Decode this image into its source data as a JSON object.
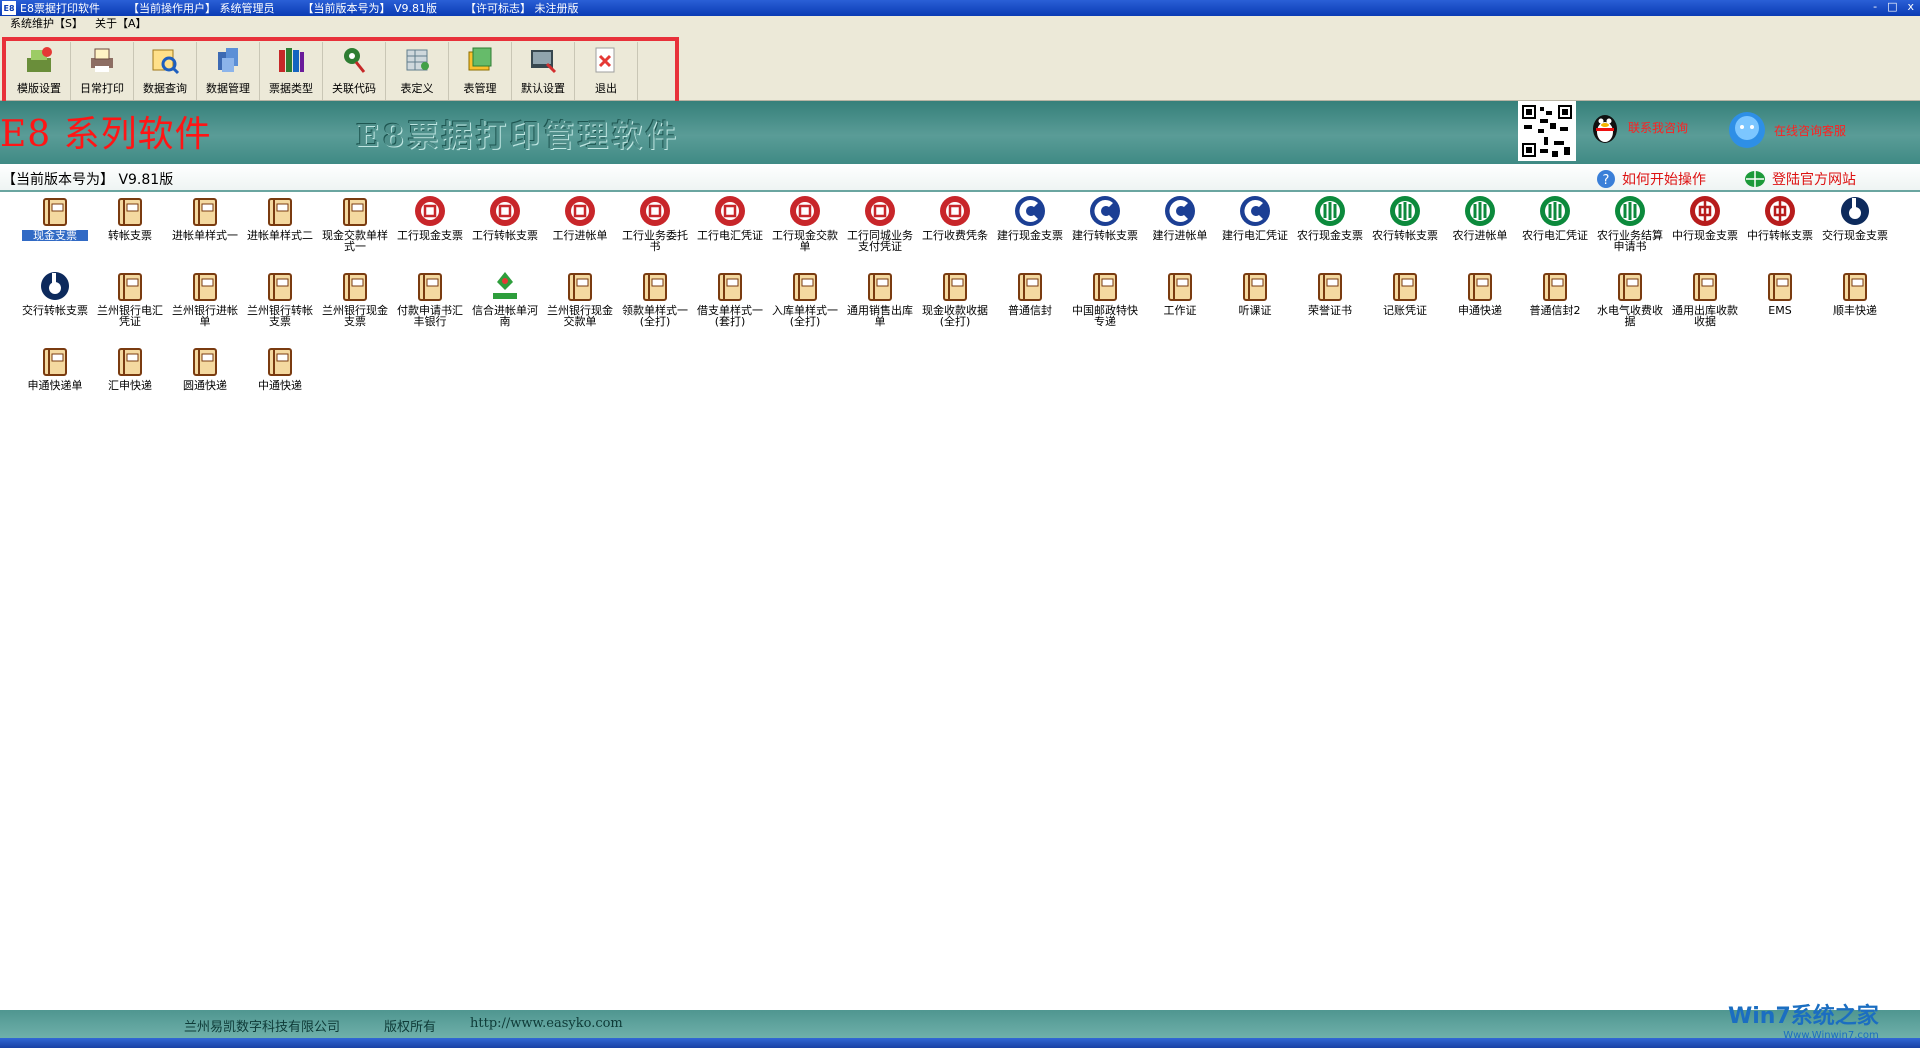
{
  "titlebar": {
    "app_name": "E8票据打印软件",
    "current_user": "【当前操作用户】 系统管理员",
    "current_version": "【当前版本号为】 V9.81版",
    "license": "【许可标志】 未注册版",
    "controls": [
      "-",
      "□",
      "x"
    ]
  },
  "menubar": {
    "items": [
      "系统维护【S】",
      "关于【A】"
    ]
  },
  "toolbar": {
    "buttons": [
      {
        "label": "模版设置",
        "icon": "template-settings-icon"
      },
      {
        "label": "日常打印",
        "icon": "printer-icon"
      },
      {
        "label": "数据查询",
        "icon": "search-icon"
      },
      {
        "label": "数据管理",
        "icon": "data-manage-icon"
      },
      {
        "label": "票据类型",
        "icon": "books-icon"
      },
      {
        "label": "关联代码",
        "icon": "link-code-icon"
      },
      {
        "label": "表定义",
        "icon": "table-define-icon"
      },
      {
        "label": "表管理",
        "icon": "table-manage-icon"
      },
      {
        "label": "默认设置",
        "icon": "default-settings-icon"
      },
      {
        "label": "退出",
        "icon": "exit-icon"
      }
    ]
  },
  "banner": {
    "series_title": "E8 系列软件",
    "product_title": "E8票据打印管理软件",
    "qq_contact": "联系我咨询",
    "online_support": "在线咨询客服"
  },
  "version_line": {
    "version": "【当前版本号为】 V9.81版",
    "how_to": "如何开始操作",
    "website": "登陆官方网站"
  },
  "items": [
    {
      "label": "现金支票",
      "icon": "book"
    },
    {
      "label": "转帐支票",
      "icon": "book"
    },
    {
      "label": "进帐单样式一",
      "icon": "book"
    },
    {
      "label": "进帐单样式二",
      "icon": "book"
    },
    {
      "label": "现金交款单样式一",
      "icon": "book"
    },
    {
      "label": "工行现金支票",
      "icon": "icbc"
    },
    {
      "label": "工行转帐支票",
      "icon": "icbc"
    },
    {
      "label": "工行进帐单",
      "icon": "icbc"
    },
    {
      "label": "工行业务委托书",
      "icon": "icbc"
    },
    {
      "label": "工行电汇凭证",
      "icon": "icbc"
    },
    {
      "label": "工行现金交款单",
      "icon": "icbc"
    },
    {
      "label": "工行同城业务支付凭证",
      "icon": "icbc"
    },
    {
      "label": "工行收费凭条",
      "icon": "icbc"
    },
    {
      "label": "建行现金支票",
      "icon": "ccb"
    },
    {
      "label": "建行转帐支票",
      "icon": "ccb"
    },
    {
      "label": "建行进帐单",
      "icon": "ccb"
    },
    {
      "label": "建行电汇凭证",
      "icon": "ccb"
    },
    {
      "label": "农行现金支票",
      "icon": "abc"
    },
    {
      "label": "农行转帐支票",
      "icon": "abc"
    },
    {
      "label": "农行进帐单",
      "icon": "abc"
    },
    {
      "label": "农行电汇凭证",
      "icon": "abc"
    },
    {
      "label": "农行业务结算申请书",
      "icon": "abc"
    },
    {
      "label": "中行现金支票",
      "icon": "boc"
    },
    {
      "label": "中行转帐支票",
      "icon": "boc"
    },
    {
      "label": "交行现金支票",
      "icon": "bocom"
    },
    {
      "label": "交行转帐支票",
      "icon": "bocom"
    },
    {
      "label": "兰州银行电汇凭证",
      "icon": "book"
    },
    {
      "label": "兰州银行进帐单",
      "icon": "book"
    },
    {
      "label": "兰州银行转帐支票",
      "icon": "book"
    },
    {
      "label": "兰州银行现金支票",
      "icon": "book"
    },
    {
      "label": "付款申请书汇丰银行",
      "icon": "book"
    },
    {
      "label": "信合进帐单河南",
      "icon": "xinhe"
    },
    {
      "label": "兰州银行现金交款单",
      "icon": "book"
    },
    {
      "label": "领款单样式一(全打)",
      "icon": "book"
    },
    {
      "label": "借支单样式一(套打)",
      "icon": "book"
    },
    {
      "label": "入库单样式一(全打)",
      "icon": "book"
    },
    {
      "label": "通用销售出库单",
      "icon": "book"
    },
    {
      "label": "现金收款收据(全打)",
      "icon": "book"
    },
    {
      "label": "普通信封",
      "icon": "book"
    },
    {
      "label": "中国邮政特快专递",
      "icon": "book"
    },
    {
      "label": "工作证",
      "icon": "book"
    },
    {
      "label": "听课证",
      "icon": "book"
    },
    {
      "label": "荣誉证书",
      "icon": "book"
    },
    {
      "label": "记账凭证",
      "icon": "book"
    },
    {
      "label": "申通快递",
      "icon": "book"
    },
    {
      "label": "普通信封2",
      "icon": "book"
    },
    {
      "label": "水电气收费收据",
      "icon": "book"
    },
    {
      "label": "通用出库收款收据",
      "icon": "book"
    },
    {
      "label": "EMS",
      "icon": "book"
    },
    {
      "label": "顺丰快递",
      "icon": "book"
    },
    {
      "label": "申通快递单",
      "icon": "book"
    },
    {
      "label": "汇申快递",
      "icon": "book"
    },
    {
      "label": "圆通快递",
      "icon": "book"
    },
    {
      "label": "中通快递",
      "icon": "book"
    }
  ],
  "footer": {
    "company": "兰州易凯数字科技有限公司",
    "rights": "版权所有",
    "url": "http://www.easyko.com"
  },
  "watermark": {
    "brand": "Win7系统之家",
    "url": "Www.Winwin7.com"
  },
  "colors": {
    "title_blue": "#0a3bb4",
    "banner_teal": "#4f9690",
    "highlight_red": "#e8313a",
    "icbc_red": "#c8262a",
    "ccb_blue": "#1c3f94",
    "abc_green": "#0c8a3c",
    "boc_red": "#b71c1c"
  }
}
